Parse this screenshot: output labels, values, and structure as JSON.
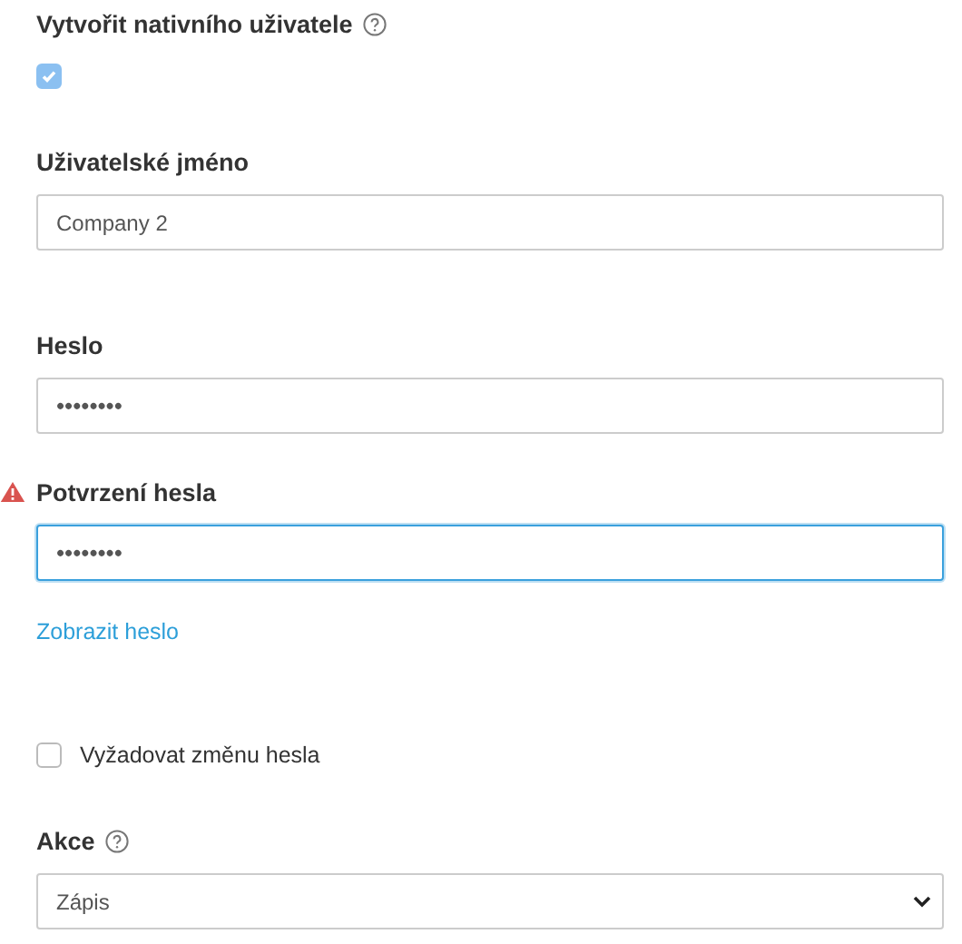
{
  "create_native_user": {
    "label": "Vytvořit nativního uživatele",
    "checked": true,
    "disabled": true
  },
  "fields": [
    {
      "kind": "text",
      "label": "Uživatelské jméno",
      "value": "Company 2",
      "error": false,
      "focused": false
    },
    {
      "kind": "password",
      "label": "Heslo",
      "value": "••••••••",
      "error": false,
      "focused": false
    },
    {
      "kind": "password",
      "label": "Potvrzení hesla",
      "value": "••••••••",
      "error": true,
      "focused": true
    }
  ],
  "show_password_link": "Zobrazit heslo",
  "require_change": {
    "label": "Vyžadovat změnu hesla",
    "checked": false
  },
  "action": {
    "label": "Akce",
    "value": "Zápis"
  }
}
